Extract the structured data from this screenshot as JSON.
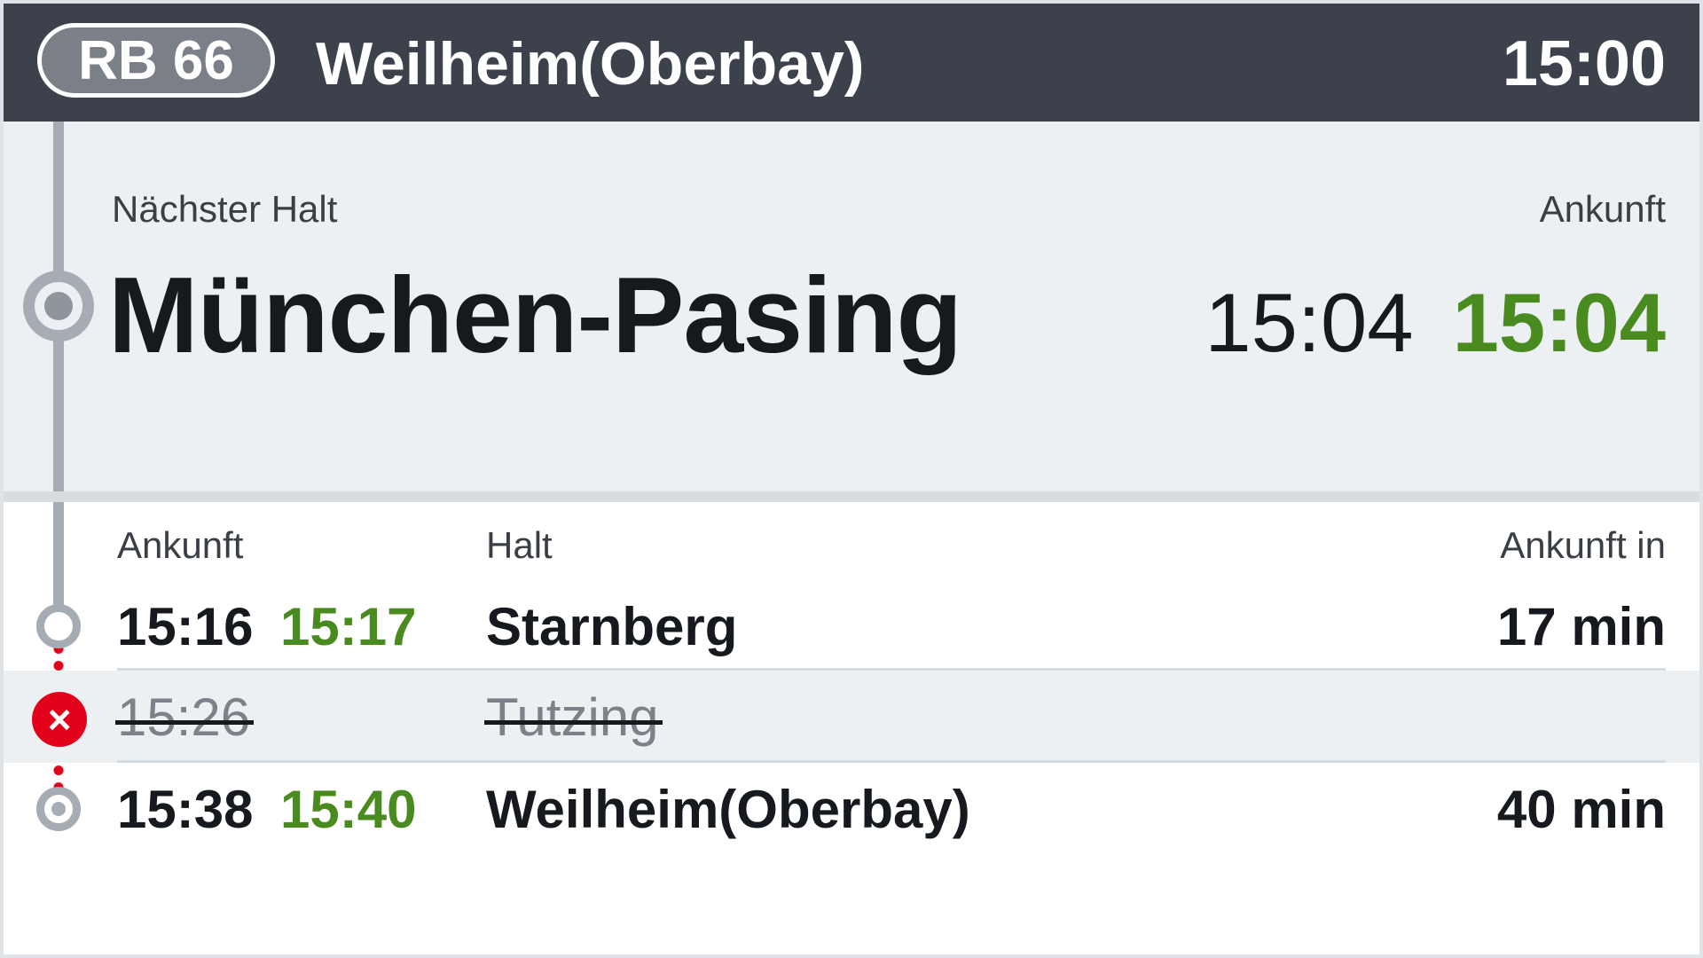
{
  "header": {
    "line": "RB 66",
    "destination": "Weilheim(Oberbay)",
    "clock": "15:00"
  },
  "next_stop": {
    "label": "Nächster Halt",
    "arrival_label": "Ankunft",
    "name": "München-Pasing",
    "scheduled": "15:04",
    "actual": "15:04"
  },
  "list": {
    "columns": {
      "arrival": "Ankunft",
      "stop": "Halt",
      "arrival_in": "Ankunft in"
    },
    "stops": [
      {
        "scheduled": "15:16",
        "actual": "15:17",
        "name": "Starnberg",
        "arrival_in": "17 min",
        "cancelled": false
      },
      {
        "scheduled": "15:26",
        "actual": "",
        "name": "Tutzing",
        "arrival_in": "",
        "cancelled": true
      },
      {
        "scheduled": "15:38",
        "actual": "15:40",
        "name": "Weilheim(Oberbay)",
        "arrival_in": "40 min",
        "cancelled": false
      }
    ]
  },
  "icons": {
    "cancel": "×",
    "stop_marker": "ring",
    "final_marker": "ring-with-dot"
  },
  "colors": {
    "header_bg": "#3c414b",
    "on_time_green": "#4a8b1f",
    "cancel_red": "#e2001a",
    "panel_bg": "#edf0f3"
  }
}
